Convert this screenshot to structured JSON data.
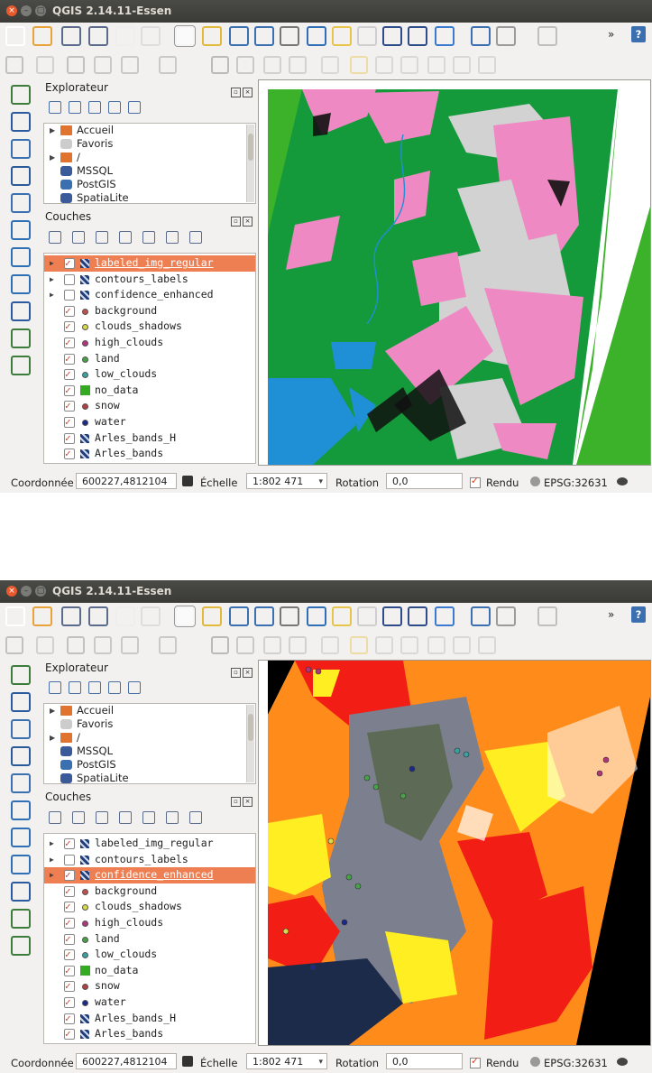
{
  "window": {
    "title": "QGIS 2.14.11-Essen",
    "close_glyph": "×",
    "min_glyph": "–",
    "max_glyph": "▢"
  },
  "browser_panel": {
    "title": "Explorateur",
    "items": [
      {
        "label": "Accueil",
        "icon": "folder-icon"
      },
      {
        "label": "Favoris",
        "icon": "star-icon"
      },
      {
        "label": "/",
        "icon": "folder-icon"
      },
      {
        "label": "MSSQL",
        "icon": "mssql-icon"
      },
      {
        "label": "PostGIS",
        "icon": "postgis-icon"
      },
      {
        "label": "SpatiaLite",
        "icon": "spatialite-icon"
      }
    ]
  },
  "layers_panel": {
    "title": "Couches",
    "layers": [
      {
        "label": "labeled_img_regular",
        "checked": true,
        "symbol": "raster"
      },
      {
        "label": "contours_labels",
        "checked": false,
        "symbol": "raster"
      },
      {
        "label": "confidence_enhanced",
        "checked": false,
        "symbol": "raster"
      },
      {
        "label": "background",
        "checked": true,
        "symbol": "dot",
        "color": "#c0504d"
      },
      {
        "label": "clouds_shadows",
        "checked": true,
        "symbol": "dot",
        "color": "#d8d84a"
      },
      {
        "label": "high_clouds",
        "checked": true,
        "symbol": "dot",
        "color": "#b0357a"
      },
      {
        "label": "land",
        "checked": true,
        "symbol": "dot",
        "color": "#48a048"
      },
      {
        "label": "low_clouds",
        "checked": true,
        "symbol": "dot",
        "color": "#3aa0a0"
      },
      {
        "label": "no_data",
        "checked": true,
        "symbol": "square",
        "color": "#33aa22"
      },
      {
        "label": "snow",
        "checked": true,
        "symbol": "dot",
        "color": "#b04040"
      },
      {
        "label": "water",
        "checked": true,
        "symbol": "dot",
        "color": "#1b2a8a"
      },
      {
        "label": "Arles_bands_H",
        "checked": true,
        "symbol": "raster"
      },
      {
        "label": "Arles_bands",
        "checked": true,
        "symbol": "raster"
      }
    ]
  },
  "screens": [
    {
      "selected_layer": 0
    },
    {
      "selected_layer": 2
    }
  ],
  "status": {
    "coord_label": "Coordonnée",
    "coord_value": "600227,4812104",
    "scale_label": "Échelle",
    "scale_value": "1:802 471",
    "rotation_label": "Rotation",
    "rotation_value": "0,0",
    "render_label": "Rendu",
    "crs": "EPSG:32631"
  },
  "colors": {
    "selection": "#ee7f52",
    "map1_pink": "#ef89c3",
    "map1_green": "#159a3b",
    "map1_lightgreen": "#3cb22a",
    "map1_grey": "#d2d2d2",
    "map1_blue": "#1f8fd6",
    "map2_orange": "#ff8c1a",
    "map2_red": "#f21d14",
    "map2_yellow": "#ffee22"
  }
}
